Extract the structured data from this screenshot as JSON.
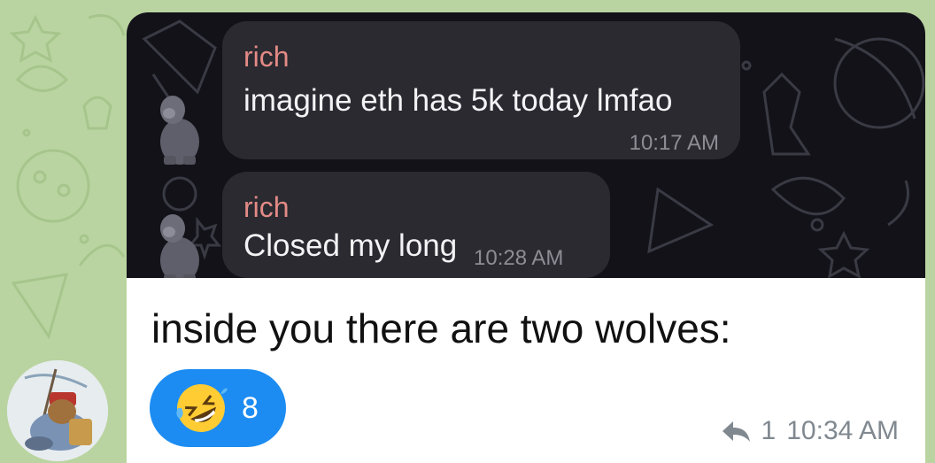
{
  "colors": {
    "chat_background": "#b9d4a0",
    "bubble_background": "#ffffff",
    "screenshot_background": "#121218",
    "inner_bubble": "#2b2a31",
    "sender_name": "#e38a86",
    "reaction_pill": "#1c8cf2"
  },
  "embedded_screenshot": {
    "messages": [
      {
        "sender": "rich",
        "text": "imagine eth has 5k today lmfao",
        "time": "10:17 AM"
      },
      {
        "sender": "rich",
        "text": "Closed my long",
        "time": "10:28 AM"
      }
    ]
  },
  "message": {
    "caption": "inside you there are two wolves:",
    "reaction": {
      "emoji_icon": "rolling-on-floor-laughing-icon",
      "count": "8"
    },
    "reply_count": "1",
    "time": "10:34 AM"
  }
}
